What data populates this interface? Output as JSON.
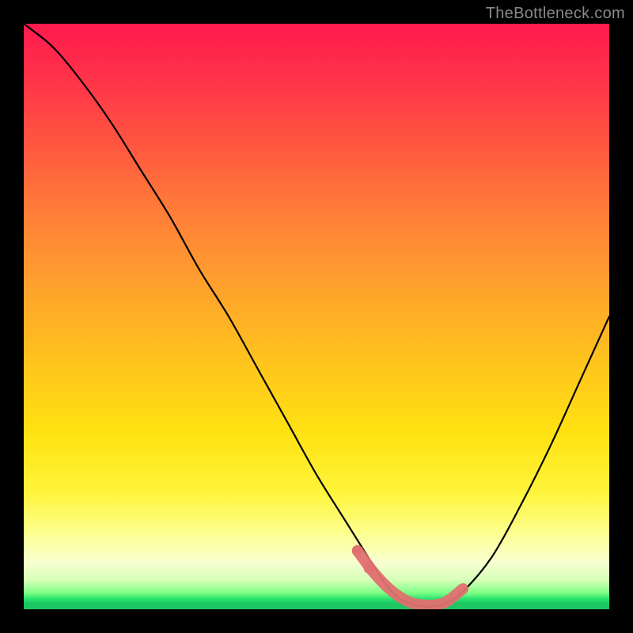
{
  "watermark": "TheBottleneck.com",
  "colors": {
    "background": "#000000",
    "curve": "#000000",
    "marker": "#e07070"
  },
  "chart_data": {
    "type": "line",
    "title": "",
    "xlabel": "",
    "ylabel": "",
    "xlim": [
      0,
      100
    ],
    "ylim": [
      0,
      100
    ],
    "series": [
      {
        "name": "bottleneck-curve",
        "x": [
          0,
          5,
          10,
          15,
          20,
          25,
          30,
          35,
          40,
          45,
          50,
          55,
          60,
          62,
          64,
          66,
          68,
          70,
          72,
          75,
          80,
          85,
          90,
          95,
          100
        ],
        "values": [
          100,
          96,
          90,
          83,
          75,
          67,
          58,
          50,
          41,
          32,
          23,
          15,
          7,
          4,
          2,
          1,
          0.5,
          0.5,
          1,
          3,
          9,
          18,
          28,
          39,
          50
        ]
      }
    ],
    "marker_region": {
      "name": "optimal-zone",
      "x": [
        57,
        60,
        63,
        66,
        69,
        72,
        75
      ],
      "values": [
        10,
        6,
        3,
        1.2,
        0.7,
        1.2,
        3.5
      ]
    },
    "marker_dots": [
      {
        "x": 57,
        "y": 10
      },
      {
        "x": 59,
        "y": 7
      }
    ]
  }
}
